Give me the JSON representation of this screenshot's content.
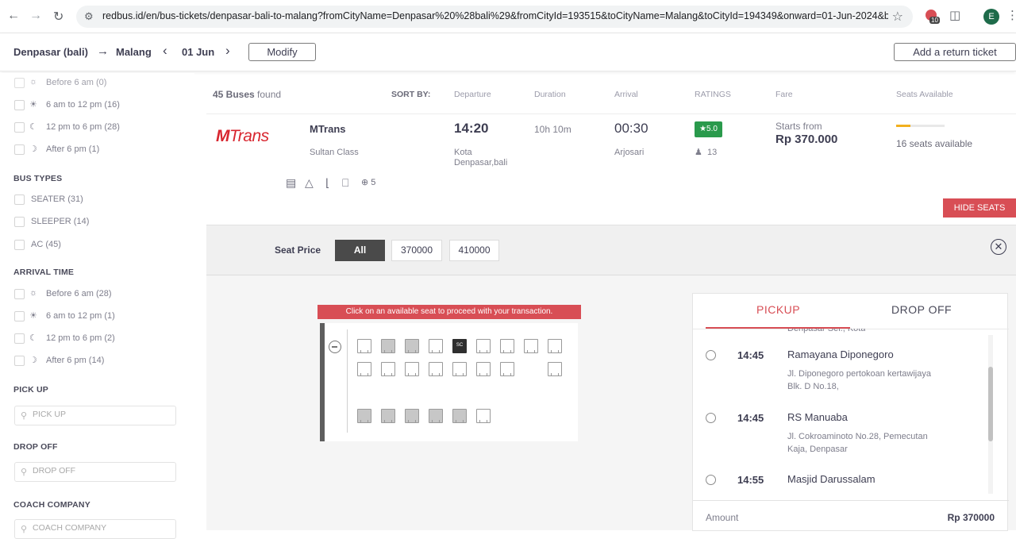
{
  "browser": {
    "url": "redbus.id/en/bus-tickets/denpasar-bali-to-malang?fromCityName=Denpasar%20%28bali%29&fromCityId=193515&toCityName=Malang&toCityId=194349&onward=01-Jun-2024&busTy...",
    "extension_badge": "10",
    "profile_initial": "E"
  },
  "search": {
    "from": "Denpasar (bali)",
    "to": "Malang",
    "date": "01 Jun",
    "modify_label": "Modify",
    "return_label": "Add a return ticket"
  },
  "sidebar": {
    "departure_partial": [
      {
        "label": "Before 6 am (0)",
        "icon": "sunrise-icon"
      },
      {
        "label": "6 am to 12 pm (16)",
        "icon": "sun-icon"
      },
      {
        "label": "12 pm to 6 pm (28)",
        "icon": "sun-half-icon"
      },
      {
        "label": "After 6 pm (1)",
        "icon": "moon-icon"
      }
    ],
    "bus_types_title": "BUS TYPES",
    "bus_types": [
      "SEATER (31)",
      "SLEEPER (14)",
      "AC (45)"
    ],
    "arrival_title": "ARRIVAL TIME",
    "arrival": [
      {
        "label": "Before 6 am (28)",
        "icon": "sunrise-icon"
      },
      {
        "label": "6 am to 12 pm (1)",
        "icon": "sun-icon"
      },
      {
        "label": "12 pm to 6 pm (2)",
        "icon": "sun-half-icon"
      },
      {
        "label": "After 6 pm (14)",
        "icon": "moon-icon"
      }
    ],
    "pickup_title": "PICK UP",
    "pickup_placeholder": "PICK UP",
    "dropoff_title": "DROP OFF",
    "dropoff_placeholder": "DROP OFF",
    "coach_title": "COACH COMPANY",
    "coach_placeholder": "COACH COMPANY"
  },
  "sort": {
    "count": "45 Buses",
    "found": "found",
    "sort_by": "SORT BY:",
    "departure": "Departure",
    "duration": "Duration",
    "arrival": "Arrival",
    "ratings": "RATINGS",
    "fare": "Fare",
    "seats": "Seats Available"
  },
  "bus": {
    "logo_m": "M",
    "logo_rest": "Trans",
    "operator": "MTrans",
    "class": "Sultan Class",
    "amenities_more": "5",
    "departure_time": "14:20",
    "departure_loc_1": "Kota",
    "departure_loc_2": "Denpasar,bali",
    "duration": "10h 10m",
    "arrival_time": "00:30",
    "arrival_loc": "Arjosari",
    "rating": "★5.0",
    "reviews": "13",
    "starts_from": "Starts from",
    "fare": "Rp 370.000",
    "seats_available": "16 seats available",
    "seats_fill_fraction": 0.3,
    "hide_seats": "HIDE SEATS"
  },
  "seat_panel": {
    "price_label": "Seat Price",
    "chips": [
      "All",
      "370000",
      "410000"
    ],
    "banner": "Click on an available seat to proceed with your transaction.",
    "special_seat": "SC"
  },
  "boarding": {
    "tab_pickup": "PICKUP",
    "tab_drop": "DROP OFF",
    "cutoff_text": "Denpasar Sel., Kota",
    "points": [
      {
        "time": "14:45",
        "name": "Ramayana Diponegoro",
        "addr": "Jl. Diponegoro pertokoan kertawijaya Blk. D No.18,"
      },
      {
        "time": "14:45",
        "name": "RS Manuaba",
        "addr": "Jl. Cokroaminoto No.28, Pemecutan Kaja, Denpasar"
      },
      {
        "time": "14:55",
        "name": "Masjid Darussalam",
        "addr": ""
      }
    ],
    "amount_label": "Amount",
    "amount": "Rp 370000"
  }
}
